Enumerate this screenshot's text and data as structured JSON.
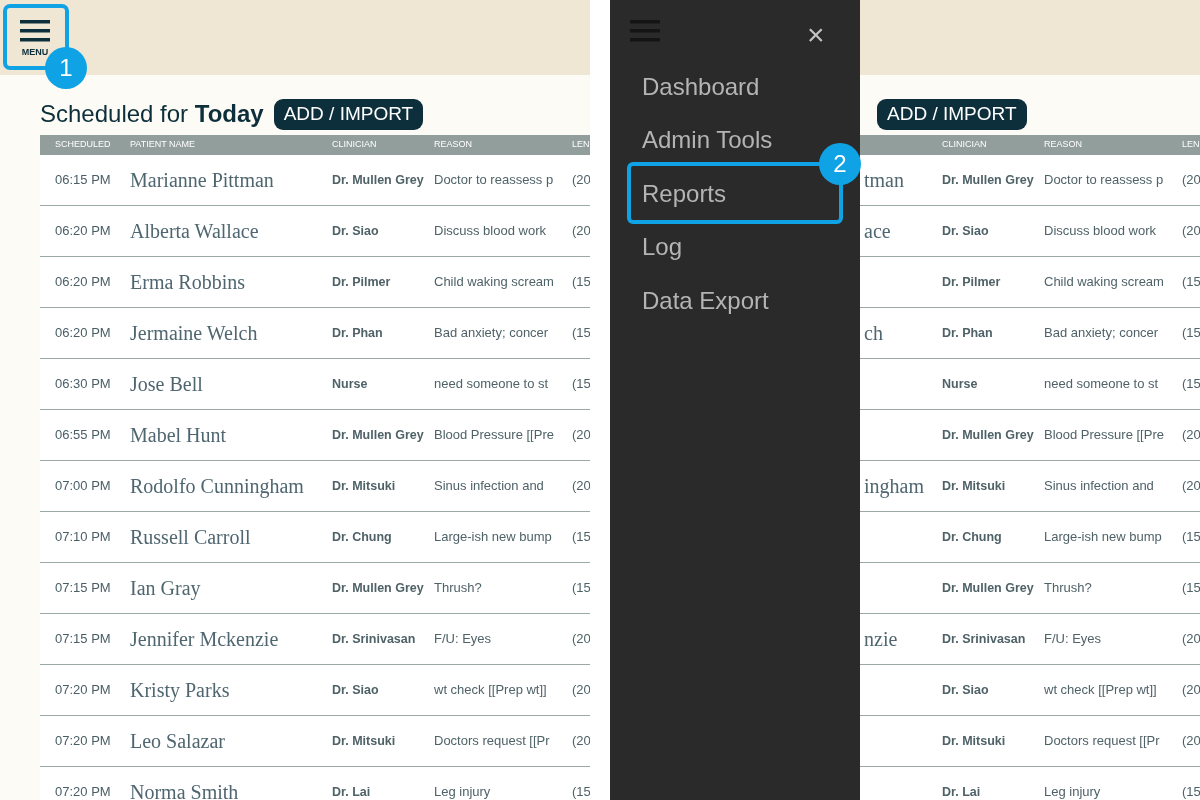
{
  "panels": [
    {
      "badge": "1",
      "header": {
        "menu_label": "MENU",
        "highlighted": true
      },
      "title": "Scheduled for **Today**",
      "add_button": "ADD / IMPORT",
      "table": {
        "columns": [
          "SCHEDULED",
          "PATIENT NAME",
          "CLINICIAN",
          "REASON",
          "LEN"
        ],
        "rows": [
          {
            "time": "06:15 PM",
            "patient": "Marianne Pittman",
            "clinician": "Dr. Mullen Grey",
            "reason": "Doctor to reassess p",
            "length": "(20"
          },
          {
            "time": "06:20 PM",
            "patient": "Alberta Wallace",
            "clinician": "Dr. Siao",
            "reason": "Discuss blood work",
            "length": "(20"
          },
          {
            "time": "06:20 PM",
            "patient": "Erma Robbins",
            "clinician": "Dr. Pilmer",
            "reason": "Child waking scream",
            "length": "(15"
          },
          {
            "time": "06:20 PM",
            "patient": "Jermaine Welch",
            "clinician": "Dr. Phan",
            "reason": "Bad anxiety; concer",
            "length": "(15"
          },
          {
            "time": "06:30 PM",
            "patient": "Jose Bell",
            "clinician": "Nurse",
            "reason": "need someone to st",
            "length": "(15"
          },
          {
            "time": "06:55 PM",
            "patient": "Mabel Hunt",
            "clinician": "Dr. Mullen Grey",
            "reason": "Blood Pressure [[Pre",
            "length": "(20"
          },
          {
            "time": "07:00 PM",
            "patient": "Rodolfo Cunningham",
            "clinician": "Dr. Mitsuki",
            "reason": "Sinus infection and",
            "length": "(20"
          },
          {
            "time": "07:10 PM",
            "patient": "Russell Carroll",
            "clinician": "Dr. Chung",
            "reason": "Large-ish new bump",
            "length": "(15"
          },
          {
            "time": "07:15 PM",
            "patient": "Ian Gray",
            "clinician": "Dr. Mullen Grey",
            "reason": "Thrush?",
            "length": "(15"
          },
          {
            "time": "07:15 PM",
            "patient": "Jennifer Mckenzie",
            "clinician": "Dr. Srinivasan",
            "reason": "F/U: Eyes",
            "length": "(20"
          },
          {
            "time": "07:20 PM",
            "patient": "Kristy Parks",
            "clinician": "Dr. Siao",
            "reason": "wt check [[Prep wt]]",
            "length": "(20"
          },
          {
            "time": "07:20 PM",
            "patient": "Leo Salazar",
            "clinician": "Dr. Mitsuki",
            "reason": "Doctors request [[Pr",
            "length": "(20"
          },
          {
            "time": "07:20 PM",
            "patient": "Norma Smith",
            "clinician": "Dr. Lai",
            "reason": "Leg injury",
            "length": "(15"
          }
        ]
      }
    },
    {
      "badge": "2",
      "add_button": "ADD / IMPORT",
      "table": {
        "columns": [
          "CLINICIAN",
          "REASON",
          "LEN"
        ],
        "rows": [
          {
            "patient_fragment": "tman",
            "clinician": "Dr. Mullen Grey",
            "reason": "Doctor to reassess p",
            "length": "(20"
          },
          {
            "patient_fragment": "ace",
            "clinician": "Dr. Siao",
            "reason": "Discuss blood work",
            "length": "(20"
          },
          {
            "clinician": "Dr. Pilmer",
            "reason": "Child waking scream",
            "length": "(15"
          },
          {
            "patient_fragment": "ch",
            "clinician": "Dr. Phan",
            "reason": "Bad anxiety; concer",
            "length": "(15"
          },
          {
            "clinician": "Nurse",
            "reason": "need someone to st",
            "length": "(15"
          },
          {
            "clinician": "Dr. Mullen Grey",
            "reason": "Blood Pressure [[Pre",
            "length": "(20"
          },
          {
            "patient_fragment": "ingham",
            "clinician": "Dr. Mitsuki",
            "reason": "Sinus infection and",
            "length": "(20"
          },
          {
            "clinician": "Dr. Chung",
            "reason": "Large-ish new bump",
            "length": "(15"
          },
          {
            "clinician": "Dr. Mullen Grey",
            "reason": "Thrush?",
            "length": "(15"
          },
          {
            "patient_fragment": "nzie",
            "clinician": "Dr. Srinivasan",
            "reason": "F/U: Eyes",
            "length": "(20"
          },
          {
            "clinician": "Dr. Siao",
            "reason": "wt check [[Prep wt]]",
            "length": "(20"
          },
          {
            "clinician": "Dr. Mitsuki",
            "reason": "Doctors request [[Pr",
            "length": "(20"
          },
          {
            "clinician": "Dr. Lai",
            "reason": "Leg injury",
            "length": "(15"
          }
        ]
      },
      "drawer": {
        "close": "×",
        "items": [
          {
            "label": "Dashboard",
            "highlighted": false
          },
          {
            "label": "Admin Tools",
            "highlighted": false
          },
          {
            "label": "Reports",
            "highlighted": true
          },
          {
            "label": "Log",
            "highlighted": false
          },
          {
            "label": "Data Export",
            "highlighted": false
          }
        ]
      }
    }
  ]
}
